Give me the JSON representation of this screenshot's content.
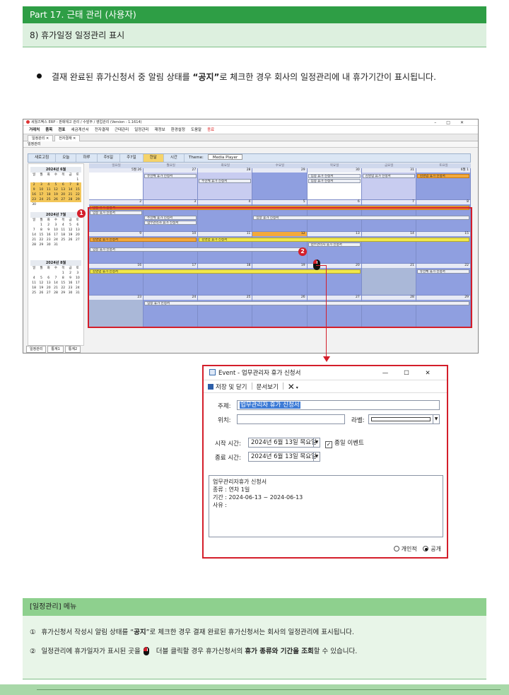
{
  "header": {
    "part_title": "Part 17. 근태 관리 (사용자)",
    "section_title": "8) 휴가일정 일정관리 표시"
  },
  "bullet": {
    "before": "결재 완료된 휴가신청서 중 알림 상태를 ",
    "bold": "“공지”",
    "after": "로 체크한 경우 회사의 일정관리에 내 휴가기간이 표시됩니다."
  },
  "erp": {
    "title": "세월즈벡스 ERP - 판매재고 관리 / 수발주 / 영업관리 (Version : 1.1614)",
    "menus": [
      {
        "label": "거래처",
        "bold": true
      },
      {
        "label": "품목",
        "bold": true
      },
      {
        "label": "전표",
        "bold": true
      },
      {
        "label": "세금계산서",
        "bold": false
      },
      {
        "label": "전자결재",
        "bold": false
      },
      {
        "label": "근태관리",
        "bold": false
      },
      {
        "label": "일정관리",
        "bold": false
      },
      {
        "label": "재정보",
        "bold": false
      },
      {
        "label": "환경설정",
        "bold": false
      },
      {
        "label": "도움말",
        "bold": false
      },
      {
        "label": "종료",
        "bold": false,
        "red": true
      }
    ],
    "tabs": [
      "일정관리",
      "전자결재"
    ],
    "section": "일정관리",
    "toolbar": [
      "새로고침",
      "오늘",
      "하루",
      "주5일",
      "주7일",
      "한달",
      "시간"
    ],
    "toolbar_active": "한달",
    "theme_label": "Theme:",
    "theme_value": "Media Player",
    "weekday_header": [
      "일요일",
      "월요일",
      "화요일",
      "수요일",
      "목요일",
      "금요일",
      "토요일"
    ],
    "mini_calendars": [
      {
        "title": "2024년 6월",
        "days": [
          "일",
          "월",
          "화",
          "수",
          "목",
          "금",
          "토"
        ],
        "cells": [
          "",
          "",
          "",
          "",
          "",
          "",
          "1",
          "2",
          "3",
          "4",
          "5",
          "6",
          "7",
          "8",
          "9",
          "10",
          "11",
          "12",
          "13",
          "14",
          "15",
          "16",
          "17",
          "18",
          "19",
          "20",
          "21",
          "22",
          "23",
          "24",
          "25",
          "26",
          "27",
          "28",
          "29",
          "30"
        ]
      },
      {
        "title": "2024년 7월",
        "days": [
          "일",
          "월",
          "화",
          "수",
          "목",
          "금",
          "토"
        ],
        "cells": [
          "",
          "1",
          "2",
          "3",
          "4",
          "5",
          "6",
          "7",
          "8",
          "9",
          "10",
          "11",
          "12",
          "13",
          "14",
          "15",
          "16",
          "17",
          "18",
          "19",
          "20",
          "21",
          "22",
          "23",
          "24",
          "25",
          "26",
          "27",
          "28",
          "29",
          "30",
          "31"
        ]
      },
      {
        "title": "2024년 8월",
        "days": [
          "일",
          "월",
          "화",
          "수",
          "목",
          "금",
          "토"
        ],
        "cells": [
          "",
          "",
          "",
          "",
          "1",
          "2",
          "3",
          "4",
          "5",
          "6",
          "7",
          "8",
          "9",
          "10",
          "11",
          "12",
          "13",
          "14",
          "15",
          "16",
          "17",
          "18",
          "19",
          "20",
          "21",
          "22",
          "23",
          "24",
          "25",
          "26",
          "27",
          "28",
          "29",
          "30",
          "31"
        ]
      }
    ],
    "week_dates": [
      [
        "5월 26",
        "27",
        "28",
        "29",
        "30",
        "31",
        "6월 1"
      ],
      [
        "2",
        "3",
        "4",
        "5",
        "6",
        "7",
        "8"
      ],
      [
        "9",
        "10",
        "11",
        "12",
        "13",
        "14",
        "15"
      ],
      [
        "16",
        "17",
        "18",
        "19",
        "20",
        "21",
        "22"
      ],
      [
        "23",
        "24",
        "25",
        "26",
        "27",
        "28",
        "29"
      ]
    ],
    "events": {
      "e1": "유선체 휴가 신청서",
      "e2": "주선체 휴가 신청서",
      "e3": "임승 휴가 신청서",
      "e4": "임승 휴가 신청서",
      "e5": "김영업 휴가 신청서",
      "e6": "김영업 휴가 신청서",
      "e7": "임승 휴가 신청서",
      "e8": "주선체 휴가 신청서",
      "e9": "업무관리자 휴가 신청서",
      "e10": "임승 휴가 신청서",
      "e11": "김영업 휴가 신청서",
      "e12": "김영업 휴가 신청서",
      "e13": "업무관리자 휴가 신청서",
      "e14": "임승 휴가 신청서",
      "e15": "김영업 휴가 신청서",
      "e16": "유선체 휴가 신청서",
      "e17": "임승 휴가 신청서"
    },
    "bottom_tabs": [
      "일정관리",
      "통계1",
      "통계2"
    ],
    "badge1": "1",
    "badge2": "2"
  },
  "dialog": {
    "title": "Event - 업무관리자 휴가 신청서",
    "min": "—",
    "max": "☐",
    "close": "✕",
    "save_close": "저장 및 닫기",
    "doc_view": "문서보기",
    "delete": "✕",
    "subject_label": "주제:",
    "subject_value": "업무관리자 휴가 신청서",
    "location_label": "위치:",
    "label_label": "라벨:",
    "start_label": "시작 시간:",
    "start_value": "2024년 6월 13일 목요일",
    "end_label": "종료 시간:",
    "end_value": "2024년 6월 13일 목요일",
    "allday_label": "종일 이벤트",
    "body_lines": [
      "업무관리자휴가 신청서",
      "종류 : 연차 1일",
      "기간 : 2024-06-13 ~ 2024-06-13",
      "사유 :"
    ],
    "private_label": "개인적",
    "public_label": "공개"
  },
  "menu_section": {
    "title": "[일정관리] 메뉴",
    "note1_num": "①",
    "note1_before": "휴가신청서 작성시 알림 상태를 “",
    "note1_bold": "공지",
    "note1_after": "”로 체크한 경우 결재 완료된 휴가신청서는 회사의 일정관리에 표시됩니다.",
    "note2_num": "②",
    "note2_before": "일정관리에 휴가일자가 표시된 곳을",
    "note2_mid": "더블 클릭할 경우 휴가신청서의 ",
    "note2_bold": "휴가 종류와 기간을 조회",
    "note2_after": "할 수 있습니다."
  }
}
